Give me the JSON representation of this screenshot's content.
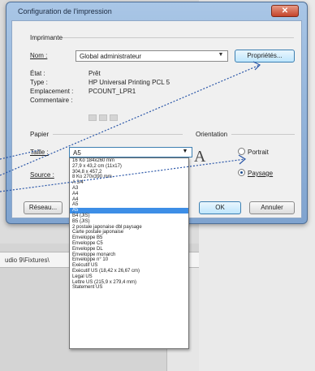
{
  "background": {
    "doc_label": "udio 9\\Fixtures\\"
  },
  "dialog": {
    "title": "Configuration de l'impression",
    "close_icon": "close-icon",
    "printer": {
      "group_label": "Imprimante",
      "name_label": "Nom :",
      "name_value": "Global administrateur",
      "properties_button": "Propriétés...",
      "status_label": "État :",
      "status_value": "Prêt",
      "type_label": "Type :",
      "type_value": "HP Universal Printing PCL 5",
      "location_label": "Emplacement :",
      "location_value": "PCOUNT_LPR1",
      "comment_label": "Commentaire :"
    },
    "paper": {
      "group_label": "Papier",
      "size_label": "Taille :",
      "size_value": "A5",
      "source_label": "Source :"
    },
    "orientation": {
      "group_label": "Orientation",
      "portrait_label": "Portrait",
      "landscape_label": "Paysage",
      "selected": "landscape"
    },
    "network_button": "Réseau...",
    "ok_button": "OK",
    "cancel_button": "Annuler"
  },
  "size_dropdown": {
    "selected_index": 9,
    "items": [
      "16 Ko 184x260 mm",
      "27,9 x 43,2 cm (11x17)",
      "304,8 x 457,2",
      "8 Ko 270x390 mm",
      "A 3/4",
      "A3",
      "A4",
      "A4",
      "A5",
      "A5",
      "B4 (JIS)",
      "B5 (JIS)",
      "2 postale japonaise dbl paysage",
      "Carte postale japonaise",
      "Enveloppe B5",
      "Enveloppe C5",
      "Enveloppe DL",
      "Enveloppe monarch",
      "Enveloppe n° 10",
      "Exécutif US",
      "Exécutif US (18,42 x 26,67 cm)",
      "Legal US",
      "Lettre US (215,9 x 279,4 mm)",
      "Statement US"
    ]
  }
}
